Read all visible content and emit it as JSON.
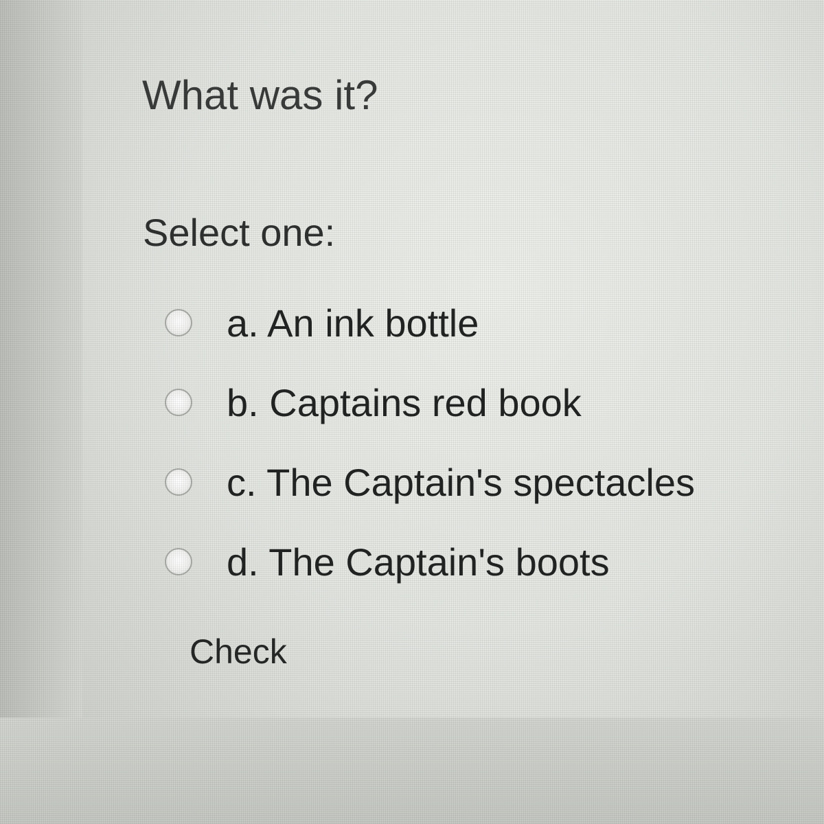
{
  "question": {
    "text": "What was it?"
  },
  "answer": {
    "prompt": "Select one:",
    "options": [
      {
        "label": "a. An ink bottle",
        "selected": false
      },
      {
        "label": "b. Captains red book",
        "selected": false
      },
      {
        "label": "c. The Captain's spectacles",
        "selected": false
      },
      {
        "label": "d. The Captain's boots",
        "selected": false
      }
    ]
  },
  "actions": {
    "check_label": "Check"
  },
  "colors": {
    "text": "#2a2c2b",
    "background": "#e4e7e2"
  }
}
